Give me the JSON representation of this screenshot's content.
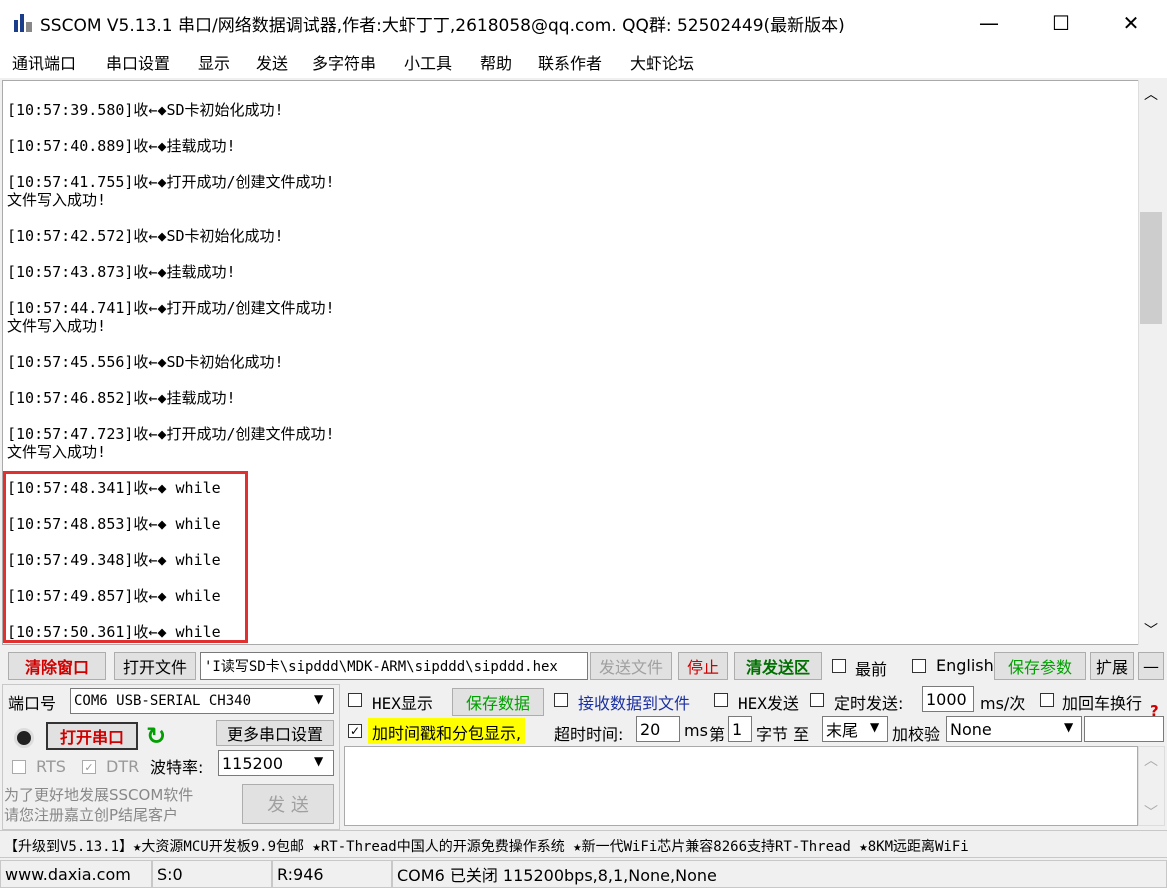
{
  "window": {
    "title": "SSCOM V5.13.1 串口/网络数据调试器,作者:大虾丁丁,2618058@qq.com. QQ群:  52502449(最新版本)",
    "minimize": "—",
    "maximize": "☐",
    "close": "✕"
  },
  "menu": [
    "通讯端口",
    "串口设置",
    "显示",
    "发送",
    "多字符串",
    "小工具",
    "帮助",
    "联系作者",
    "大虾论坛"
  ],
  "log": [
    "[10:57:39.580]收←◆SD卡初始化成功!",
    "[10:57:40.889]收←◆挂载成功!",
    "[10:57:41.755]收←◆打开成功/创建文件成功!",
    "文件写入成功!",
    "[10:57:42.572]收←◆SD卡初始化成功!",
    "[10:57:43.873]收←◆挂载成功!",
    "[10:57:44.741]收←◆打开成功/创建文件成功!",
    "文件写入成功!",
    "[10:57:45.556]收←◆SD卡初始化成功!",
    "[10:57:46.852]收←◆挂载成功!",
    "[10:57:47.723]收←◆打开成功/创建文件成功!",
    "文件写入成功!",
    "[10:57:48.341]收←◆ while",
    "[10:57:48.853]收←◆ while",
    "[10:57:49.348]收←◆ while",
    "[10:57:49.857]收←◆ while",
    "[10:57:50.361]收←◆ while"
  ],
  "toolbar": {
    "clear_window": "清除窗口",
    "open_file": "打开文件",
    "file_path": "'I读写SD卡\\sipddd\\MDK-ARM\\sipddd\\sipddd.hex",
    "send_file": "发送文件",
    "stop": "停止",
    "clear_send": "清发送区",
    "last": "最前",
    "english": "English",
    "save_params": "保存参数",
    "expand": "扩展",
    "collapse": "—"
  },
  "port": {
    "port_label": "端口号",
    "port_value": "COM6 USB-SERIAL CH340",
    "open_port": "打开串口",
    "more_settings": "更多串口设置",
    "rts": "RTS",
    "dtr": "DTR",
    "baud_label": "波特率:",
    "baud_value": "115200",
    "promo_line1": "为了更好地发展SSCOM软件",
    "promo_line2": "请您注册嘉立创P结尾客户",
    "send_button": "发 送"
  },
  "options": {
    "hex_display": "HEX显示",
    "save_data": "保存数据",
    "receive_to_file": "接收数据到文件",
    "hex_send": "HEX发送",
    "timed_send": "定时发送:",
    "timed_value": "1000",
    "timed_unit": "ms/次",
    "add_crlf": "加回车换行",
    "add_timestamp": "加时间戳和分包显示,",
    "timeout_label": "超时时间:",
    "timeout_value": "20",
    "timeout_unit": "ms",
    "byte_prefix": "第",
    "byte_value": "1",
    "byte_suffix": "字节 至",
    "end_value": "末尾",
    "checksum_label": "加校验",
    "checksum_value": "None",
    "help_mark": "?"
  },
  "ticker": "【升级到V5.13.1】★大资源MCU开发板9.9包邮 ★RT-Thread中国人的开源免费操作系统 ★新一代WiFi芯片兼容8266支持RT-Thread ★8KM远距离WiFi",
  "status": {
    "website": "www.daxia.com",
    "sent": "S:0",
    "received": "R:946",
    "port_state": "COM6 已关闭  115200bps,8,1,None,None"
  },
  "colors": {
    "highlight_box": "#e03030",
    "save_green": "#00a000",
    "open_red": "#d00000",
    "timestamp_bg": "#ffff00"
  }
}
